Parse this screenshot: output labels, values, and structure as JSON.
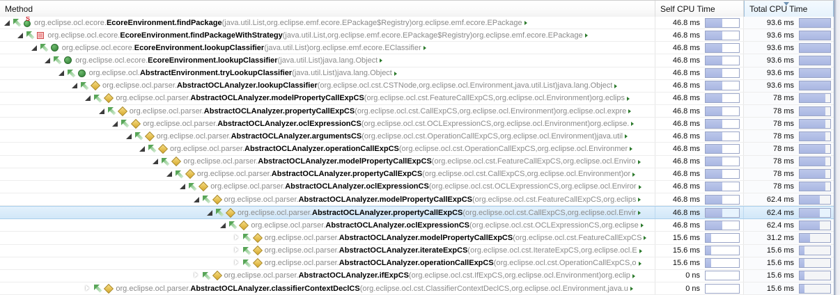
{
  "header": {
    "method": "Method",
    "self": "Self CPU Time",
    "total": "Total CPU Time",
    "sorted_column": "Total CPU Time",
    "sort_direction": "descending"
  },
  "colors": {
    "bar_fill": "#aab7e2",
    "bar_border": "#99a4c6",
    "selection_bg": "#d2e7f8",
    "sorted_header_bg": "#e6f2fc",
    "package_text": "#8a8a8a",
    "method_text": "#000000",
    "more_arrow": "#2c7a2c"
  },
  "rows": [
    {
      "level": 0,
      "toggle": "expanded",
      "icon": "green-ball-s",
      "pkg": "org.eclipse.ocl.ecore.",
      "name": "EcoreEnvironment.findPackage",
      "sig": "(java.util.List,org.eclipse.emf.ecore.EPackage$Registry)org.eclipse.emf.ecore.EPackage",
      "self": "46.8 ms",
      "total": "93.6 ms",
      "self_pct": 50,
      "total_pct": 100,
      "selected": false
    },
    {
      "level": 1,
      "toggle": "expanded",
      "icon": "red-square",
      "pkg": "org.eclipse.ocl.ecore.",
      "name": "EcoreEnvironment.findPackageWithStrategy",
      "sig": "(java.util.List,org.eclipse.emf.ecore.EPackage$Registry)org.eclipse.emf.ecore.EPackage",
      "self": "46.8 ms",
      "total": "93.6 ms",
      "self_pct": 50,
      "total_pct": 100,
      "selected": false
    },
    {
      "level": 2,
      "toggle": "expanded",
      "icon": "green-circle",
      "pkg": "org.eclipse.ocl.ecore.",
      "name": "EcoreEnvironment.lookupClassifier",
      "sig": "(java.util.List)org.eclipse.emf.ecore.EClassifier",
      "self": "46.8 ms",
      "total": "93.6 ms",
      "self_pct": 50,
      "total_pct": 100,
      "selected": false
    },
    {
      "level": 3,
      "toggle": "expanded",
      "icon": "green-circle",
      "pkg": "org.eclipse.ocl.ecore.",
      "name": "EcoreEnvironment.lookupClassifier",
      "sig": "(java.util.List)java.lang.Object",
      "self": "46.8 ms",
      "total": "93.6 ms",
      "self_pct": 50,
      "total_pct": 100,
      "selected": false
    },
    {
      "level": 4,
      "toggle": "expanded",
      "icon": "green-circle",
      "pkg": "org.eclipse.ocl.",
      "name": "AbstractEnvironment.tryLookupClassifier",
      "sig": "(java.util.List)java.lang.Object",
      "self": "46.8 ms",
      "total": "93.6 ms",
      "self_pct": 50,
      "total_pct": 100,
      "selected": false
    },
    {
      "level": 5,
      "toggle": "expanded",
      "icon": "gold-diamond",
      "pkg": "org.eclipse.ocl.parser.",
      "name": "AbstractOCLAnalyzer.lookupClassifier",
      "sig": "(org.eclipse.ocl.cst.CSTNode,org.eclipse.ocl.Environment,java.util.List)java.lang.Object",
      "self": "46.8 ms",
      "total": "93.6 ms",
      "self_pct": 50,
      "total_pct": 100,
      "selected": false
    },
    {
      "level": 6,
      "toggle": "expanded",
      "icon": "gold-diamond",
      "pkg": "org.eclipse.ocl.parser.",
      "name": "AbstractOCLAnalyzer.modelPropertyCallExpCS",
      "sig": "(org.eclipse.ocl.cst.FeatureCallExpCS,org.eclipse.ocl.Environment)org.eclips",
      "self": "46.8 ms",
      "total": "78 ms",
      "self_pct": 50,
      "total_pct": 83.3,
      "selected": false
    },
    {
      "level": 7,
      "toggle": "expanded",
      "icon": "gold-diamond",
      "pkg": "org.eclipse.ocl.parser.",
      "name": "AbstractOCLAnalyzer.propertyCallExpCS",
      "sig": "(org.eclipse.ocl.cst.CallExpCS,org.eclipse.ocl.Environment)org.eclipse.ocl.expre",
      "self": "46.8 ms",
      "total": "78 ms",
      "self_pct": 50,
      "total_pct": 83.3,
      "selected": false
    },
    {
      "level": 8,
      "toggle": "expanded",
      "icon": "gold-diamond",
      "pkg": "org.eclipse.ocl.parser.",
      "name": "AbstractOCLAnalyzer.oclExpressionCS",
      "sig": "(org.eclipse.ocl.cst.OCLExpressionCS,org.eclipse.ocl.Environment)org.eclipse.",
      "self": "46.8 ms",
      "total": "78 ms",
      "self_pct": 50,
      "total_pct": 83.3,
      "selected": false
    },
    {
      "level": 9,
      "toggle": "expanded",
      "icon": "gold-diamond",
      "pkg": "org.eclipse.ocl.parser.",
      "name": "AbstractOCLAnalyzer.argumentsCS",
      "sig": "(org.eclipse.ocl.cst.OperationCallExpCS,org.eclipse.ocl.Environment)java.util",
      "self": "46.8 ms",
      "total": "78 ms",
      "self_pct": 50,
      "total_pct": 83.3,
      "selected": false
    },
    {
      "level": 10,
      "toggle": "expanded",
      "icon": "gold-diamond",
      "pkg": "org.eclipse.ocl.parser.",
      "name": "AbstractOCLAnalyzer.operationCallExpCS",
      "sig": "(org.eclipse.ocl.cst.OperationCallExpCS,org.eclipse.ocl.Environmer",
      "self": "46.8 ms",
      "total": "78 ms",
      "self_pct": 50,
      "total_pct": 83.3,
      "selected": false
    },
    {
      "level": 11,
      "toggle": "expanded",
      "icon": "gold-diamond",
      "pkg": "org.eclipse.ocl.parser.",
      "name": "AbstractOCLAnalyzer.modelPropertyCallExpCS",
      "sig": "(org.eclipse.ocl.cst.FeatureCallExpCS,org.eclipse.ocl.Enviro",
      "self": "46.8 ms",
      "total": "78 ms",
      "self_pct": 50,
      "total_pct": 83.3,
      "selected": false
    },
    {
      "level": 12,
      "toggle": "expanded",
      "icon": "gold-diamond",
      "pkg": "org.eclipse.ocl.parser.",
      "name": "AbstractOCLAnalyzer.propertyCallExpCS",
      "sig": "(org.eclipse.ocl.cst.CallExpCS,org.eclipse.ocl.Environment)or",
      "self": "46.8 ms",
      "total": "78 ms",
      "self_pct": 50,
      "total_pct": 83.3,
      "selected": false
    },
    {
      "level": 13,
      "toggle": "expanded",
      "icon": "gold-diamond",
      "pkg": "org.eclipse.ocl.parser.",
      "name": "AbstractOCLAnalyzer.oclExpressionCS",
      "sig": "(org.eclipse.ocl.cst.OCLExpressionCS,org.eclipse.ocl.Enviror",
      "self": "46.8 ms",
      "total": "78 ms",
      "self_pct": 50,
      "total_pct": 83.3,
      "selected": false
    },
    {
      "level": 14,
      "toggle": "expanded",
      "icon": "gold-diamond",
      "pkg": "org.eclipse.ocl.parser.",
      "name": "AbstractOCLAnalyzer.modelPropertyCallExpCS",
      "sig": "(org.eclipse.ocl.cst.FeatureCallExpCS,org.eclips",
      "self": "46.8 ms",
      "total": "62.4 ms",
      "self_pct": 50,
      "total_pct": 66.7,
      "selected": false
    },
    {
      "level": 15,
      "toggle": "expanded",
      "icon": "gold-diamond",
      "pkg": "org.eclipse.ocl.parser.",
      "name": "AbstractOCLAnalyzer.propertyCallExpCS",
      "sig": "(org.eclipse.ocl.cst.CallExpCS,org.eclipse.ocl.Envir",
      "self": "46.8 ms",
      "total": "62.4 ms",
      "self_pct": 50,
      "total_pct": 66.7,
      "selected": true
    },
    {
      "level": 16,
      "toggle": "expanded",
      "icon": "gold-diamond",
      "pkg": "org.eclipse.ocl.parser.",
      "name": "AbstractOCLAnalyzer.oclExpressionCS",
      "sig": "(org.eclipse.ocl.cst.OCLExpressionCS,org.eclipse",
      "self": "46.8 ms",
      "total": "62.4 ms",
      "self_pct": 50,
      "total_pct": 66.7,
      "selected": false
    },
    {
      "level": 17,
      "toggle": "collapsed",
      "icon": "gold-diamond",
      "pkg": "org.eclipse.ocl.parser.",
      "name": "AbstractOCLAnalyzer.modelPropertyCallExpCS",
      "sig": "(org.eclipse.ocl.cst.FeatureCallExpCS",
      "self": "15.6 ms",
      "total": "31.2 ms",
      "self_pct": 16.7,
      "total_pct": 33.3,
      "selected": false
    },
    {
      "level": 17,
      "toggle": "collapsed",
      "icon": "gold-diamond",
      "pkg": "org.eclipse.ocl.parser.",
      "name": "AbstractOCLAnalyzer.iterateExpCS",
      "sig": "(org.eclipse.ocl.cst.IterateExpCS,org.eclipse.ocl.E",
      "self": "15.6 ms",
      "total": "15.6 ms",
      "self_pct": 16.7,
      "total_pct": 16.7,
      "selected": false
    },
    {
      "level": 17,
      "toggle": "collapsed",
      "icon": "gold-diamond",
      "pkg": "org.eclipse.ocl.parser.",
      "name": "AbstractOCLAnalyzer.operationCallExpCS",
      "sig": "(org.eclipse.ocl.cst.OperationCallExpCS,o",
      "self": "15.6 ms",
      "total": "15.6 ms",
      "self_pct": 16.7,
      "total_pct": 16.7,
      "selected": false
    },
    {
      "level": 14,
      "toggle": "collapsed",
      "icon": "gold-diamond",
      "pkg": "org.eclipse.ocl.parser.",
      "name": "AbstractOCLAnalyzer.ifExpCS",
      "sig": "(org.eclipse.ocl.cst.IfExpCS,org.eclipse.ocl.Environment)org.eclip",
      "self": "0 ns",
      "total": "15.6 ms",
      "self_pct": 0,
      "total_pct": 16.7,
      "selected": false
    },
    {
      "level": 6,
      "toggle": "collapsed",
      "icon": "gold-diamond",
      "pkg": "org.eclipse.ocl.parser.",
      "name": "AbstractOCLAnalyzer.classifierContextDeclCS",
      "sig": "(org.eclipse.ocl.cst.ClassifierContextDeclCS,org.eclipse.ocl.Environment,java.u",
      "self": "0 ns",
      "total": "15.6 ms",
      "self_pct": 0,
      "total_pct": 16.7,
      "selected": false
    }
  ]
}
